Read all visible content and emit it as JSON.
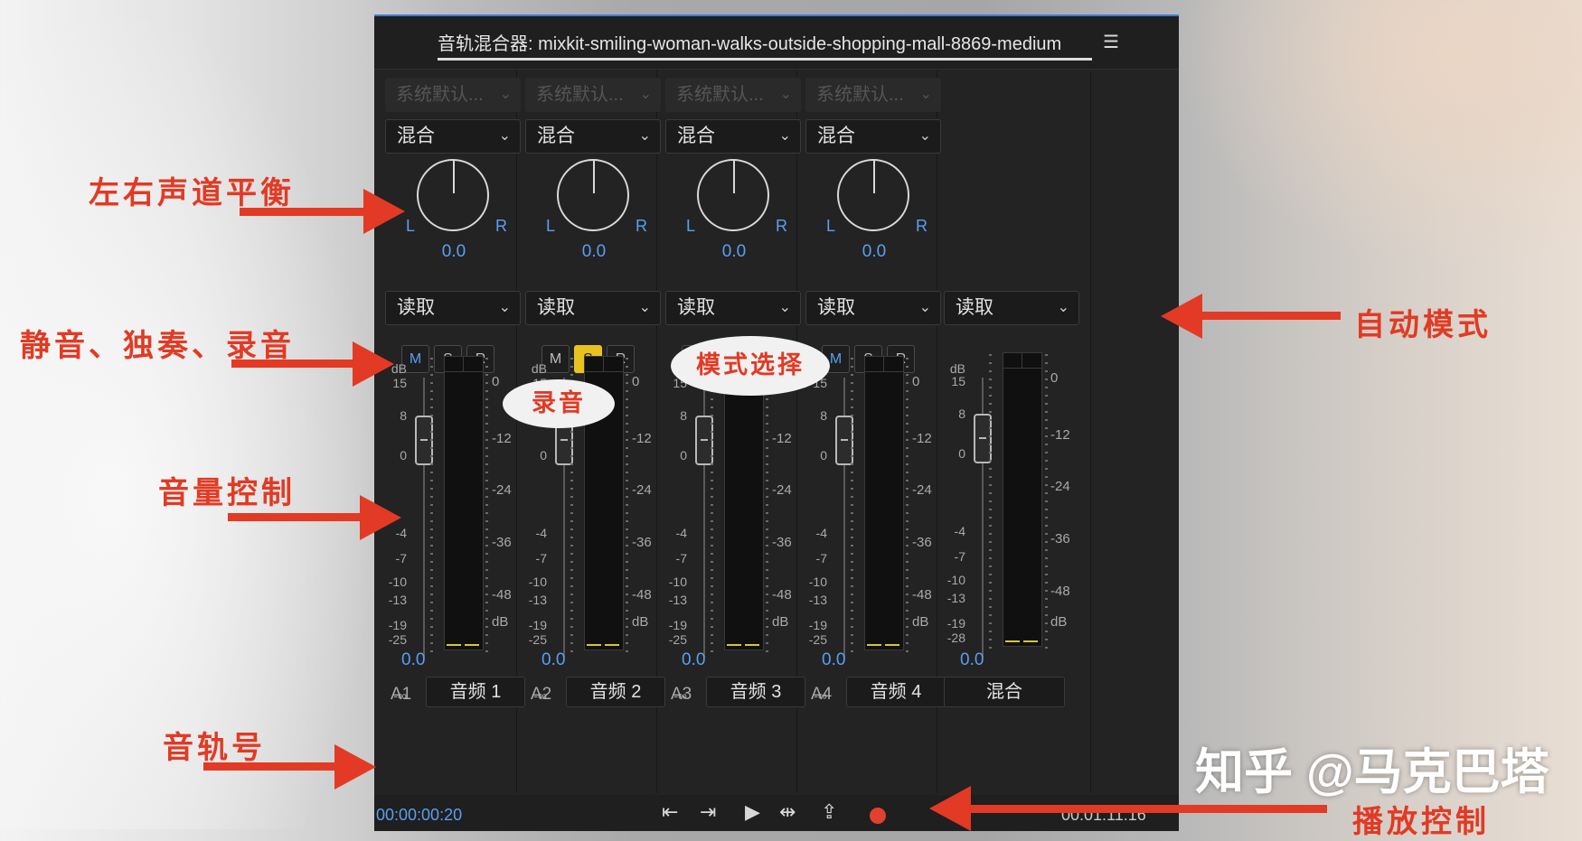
{
  "window": {
    "title": "音轨混合器: mixkit-smiling-woman-walks-outside-shopping-mall-8869-medium",
    "menu_icon": "hamburger-menu-icon"
  },
  "channels": [
    {
      "input": "系统默认...",
      "mode": "混合",
      "pan_l": "L",
      "pan_r": "R",
      "pan_value": "0.0",
      "automation": "读取",
      "m": "M",
      "s": "S",
      "r": "R",
      "volume": "0.0",
      "id": "A1",
      "name": "音频 1",
      "m_active": true,
      "s_active": false
    },
    {
      "input": "系统默认...",
      "mode": "混合",
      "pan_l": "L",
      "pan_r": "R",
      "pan_value": "0.0",
      "automation": "读取",
      "m": "M",
      "s": "S",
      "r": "R",
      "volume": "0.0",
      "id": "A2",
      "name": "音频 2",
      "m_active": false,
      "s_active": true
    },
    {
      "input": "系统默认...",
      "mode": "混合",
      "pan_l": "L",
      "pan_r": "R",
      "pan_value": "0.0",
      "automation": "读取",
      "m": "M",
      "s": "S",
      "r": "R",
      "volume": "0.0",
      "id": "A3",
      "name": "音频 3",
      "m_active": false,
      "s_active": false
    },
    {
      "input": "系统默认...",
      "mode": "混合",
      "pan_l": "L",
      "pan_r": "R",
      "pan_value": "0.0",
      "automation": "读取",
      "m": "M",
      "s": "S",
      "r": "R",
      "volume": "0.0",
      "id": "A4",
      "name": "音频 4",
      "m_active": true,
      "s_active": false
    }
  ],
  "master": {
    "automation": "读取",
    "volume": "0.0",
    "name": "混合"
  },
  "fader_scale": {
    "unit": "dB",
    "ticks": [
      "15",
      "8",
      "0",
      "-4",
      "-7",
      "-10",
      "-13",
      "-19",
      "-25",
      "-∞"
    ]
  },
  "master_scale": {
    "unit": "dB",
    "ticks": [
      "15",
      "8",
      "0",
      "-4",
      "-7",
      "-10",
      "-13",
      "-19",
      "-28",
      "-∞"
    ]
  },
  "meter_scale": {
    "ticks": [
      "0",
      "-12",
      "-24",
      "-36",
      "-48"
    ],
    "unit": "dB"
  },
  "transport": {
    "time_left": "00:00:00:20",
    "time_right": "00:01:11:16",
    "btn_in": "go-to-in-icon",
    "btn_out": "go-to-out-icon",
    "btn_play": "play-icon",
    "btn_inout": "play-in-to-out-icon",
    "btn_loop": "loop-icon",
    "btn_record": "record-icon"
  },
  "annotations": {
    "pan": "左右声道平衡",
    "msr": "静音、独奏、录音",
    "volume": "音量控制",
    "track": "音轨号",
    "auto": "自动模式",
    "playback": "播放控制",
    "bubble_record": "录音",
    "bubble_mode": "模式选择"
  },
  "watermark": "知乎 @马克巴塔",
  "colors": {
    "accent_blue": "#5a9ff0",
    "solo_yellow": "#e8c31f",
    "annotation_red": "#e23a24",
    "record_red": "#e0412f"
  }
}
